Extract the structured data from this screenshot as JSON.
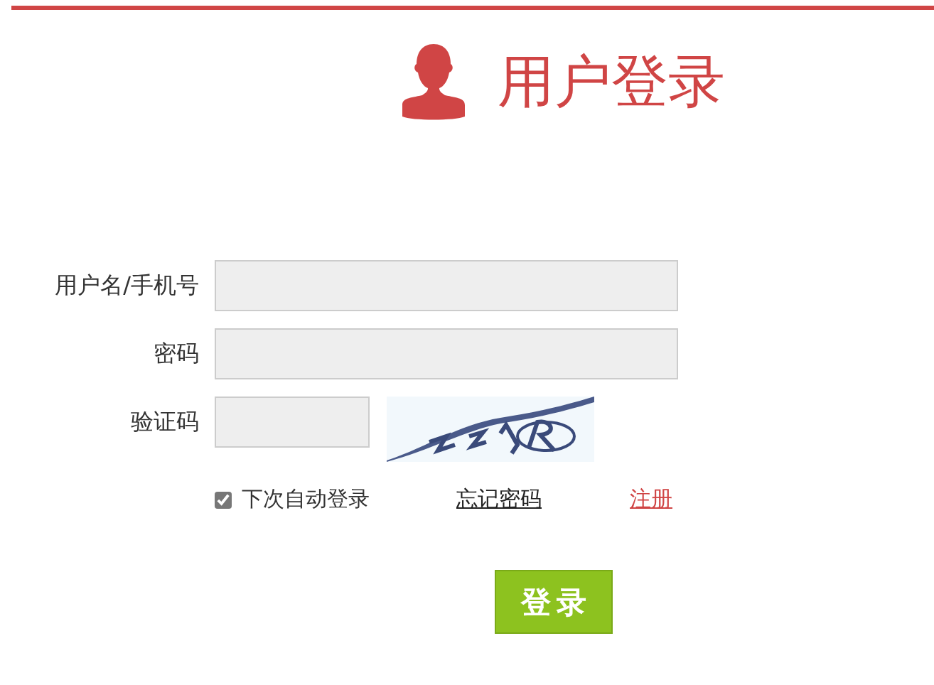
{
  "title": "用户登录",
  "fields": [
    {
      "label": "用户名/手机号",
      "kind": "text"
    },
    {
      "label": "密码",
      "kind": "password"
    },
    {
      "label": "验证码",
      "kind": "captcha"
    }
  ],
  "remember": {
    "label": "下次自动登录",
    "checked": true
  },
  "forgot_link": "忘记密码",
  "register_link": "注册",
  "login_button": "登录"
}
